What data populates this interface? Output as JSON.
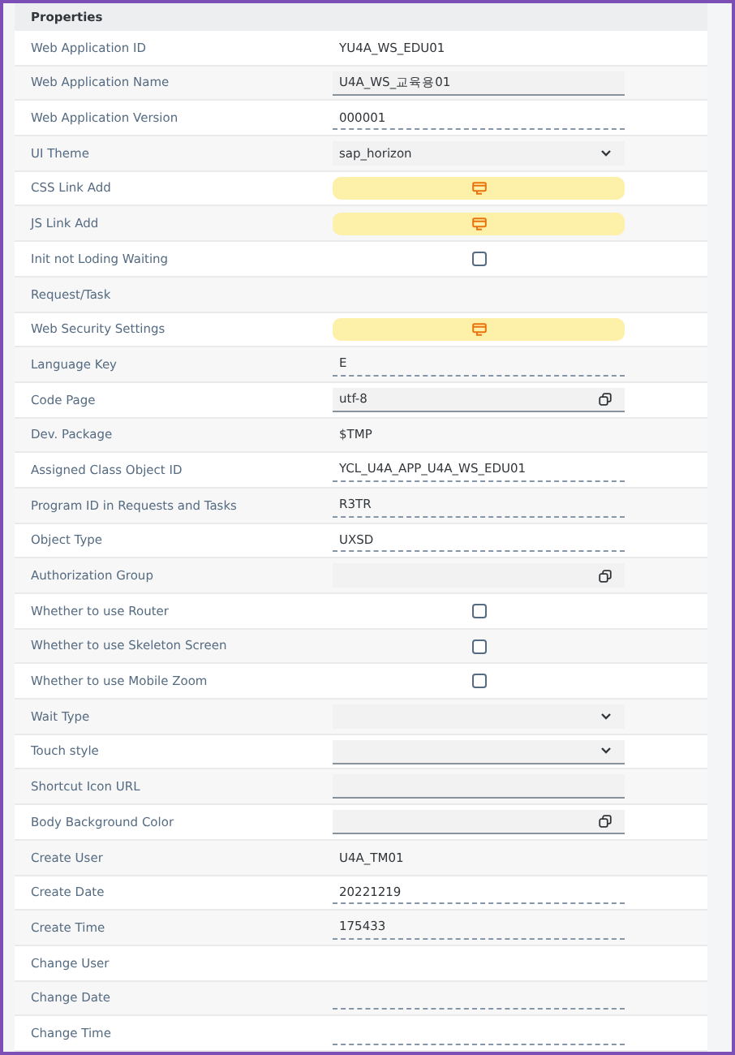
{
  "panel": {
    "title": "Properties"
  },
  "rows": [
    {
      "label": "Web Application ID",
      "kind": "text",
      "value": "YU4A_WS_EDU01"
    },
    {
      "label": "Web Application Name",
      "kind": "input",
      "editable": true,
      "value": "U4A_WS_교육용01"
    },
    {
      "label": "Web Application Version",
      "kind": "readonly",
      "value": "000001"
    },
    {
      "label": "UI Theme",
      "kind": "select",
      "editable": false,
      "value": "sap_horizon"
    },
    {
      "label": "CSS Link Add",
      "kind": "button"
    },
    {
      "label": "JS Link Add",
      "kind": "button"
    },
    {
      "label": "Init not Loding Waiting",
      "kind": "checkbox",
      "checked": false
    },
    {
      "label": "Request/Task",
      "kind": "empty"
    },
    {
      "label": "Web Security Settings",
      "kind": "button"
    },
    {
      "label": "Language Key",
      "kind": "readonly",
      "value": "E"
    },
    {
      "label": "Code Page",
      "kind": "valuehelp",
      "editable": true,
      "value": "utf-8"
    },
    {
      "label": "Dev. Package",
      "kind": "text",
      "value": "$TMP"
    },
    {
      "label": "Assigned Class Object ID",
      "kind": "readonly",
      "value": "YCL_U4A_APP_U4A_WS_EDU01"
    },
    {
      "label": "Program ID in Requests and Tasks",
      "kind": "readonly",
      "value": "R3TR"
    },
    {
      "label": "Object Type",
      "kind": "readonly",
      "value": "UXSD"
    },
    {
      "label": "Authorization Group",
      "kind": "valuehelp",
      "editable": false
    },
    {
      "label": "Whether to use Router",
      "kind": "checkbox",
      "checked": false
    },
    {
      "label": "Whether to use Skeleton Screen",
      "kind": "checkbox",
      "checked": false
    },
    {
      "label": "Whether to use Mobile Zoom",
      "kind": "checkbox",
      "checked": false
    },
    {
      "label": "Wait Type",
      "kind": "select",
      "editable": false
    },
    {
      "label": "Touch style",
      "kind": "select",
      "editable": true
    },
    {
      "label": "Shortcut Icon URL",
      "kind": "input",
      "editable": true
    },
    {
      "label": "Body Background Color",
      "kind": "valuehelp",
      "editable": true
    },
    {
      "label": "Create User",
      "kind": "text",
      "value": "U4A_TM01"
    },
    {
      "label": "Create Date",
      "kind": "readonly",
      "value": "20221219"
    },
    {
      "label": "Create Time",
      "kind": "readonly",
      "value": "175433"
    },
    {
      "label": "Change User",
      "kind": "empty"
    },
    {
      "label": "Change Date",
      "kind": "readonly"
    },
    {
      "label": "Change Time",
      "kind": "readonly"
    }
  ]
}
